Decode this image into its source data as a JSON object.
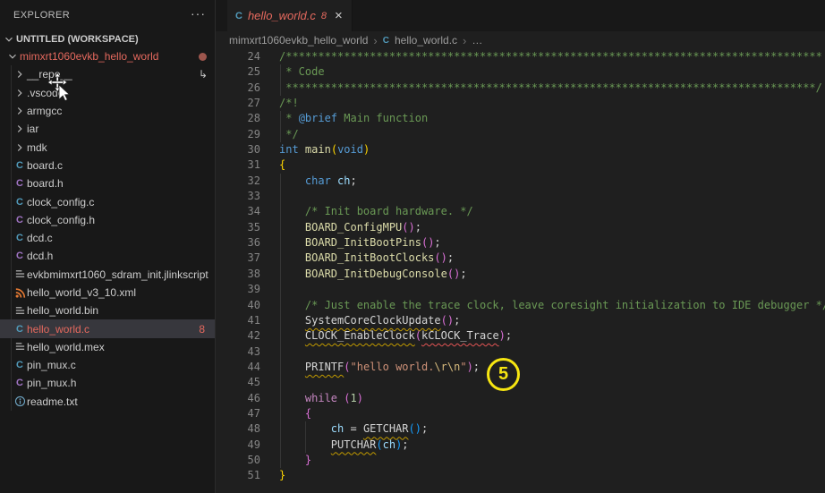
{
  "explorer": {
    "title": "EXPLORER",
    "workspace_label": "UNTITLED (WORKSPACE)",
    "tree": [
      {
        "label": "mimxrt1060evkb_hello_world",
        "type": "folder",
        "level": 0,
        "expanded": true,
        "color": "red",
        "trailing": "dot"
      },
      {
        "label": "__repo__",
        "type": "folder",
        "level": 1,
        "trailing": "return-arrow"
      },
      {
        "label": ".vscode",
        "type": "folder",
        "level": 1
      },
      {
        "label": "armgcc",
        "type": "folder",
        "level": 1
      },
      {
        "label": "iar",
        "type": "folder",
        "level": 1
      },
      {
        "label": "mdk",
        "type": "folder",
        "level": 1
      },
      {
        "label": "board.c",
        "type": "file",
        "icon": "c-source-icon",
        "level": 1
      },
      {
        "label": "board.h",
        "type": "file",
        "icon": "c-header-icon",
        "level": 1
      },
      {
        "label": "clock_config.c",
        "type": "file",
        "icon": "c-source-icon",
        "level": 1
      },
      {
        "label": "clock_config.h",
        "type": "file",
        "icon": "c-header-icon",
        "level": 1
      },
      {
        "label": "dcd.c",
        "type": "file",
        "icon": "c-source-icon",
        "level": 1
      },
      {
        "label": "dcd.h",
        "type": "file",
        "icon": "c-header-icon",
        "level": 1
      },
      {
        "label": "evkbmimxrt1060_sdram_init.jlinkscript",
        "type": "file",
        "icon": "doc-icon",
        "level": 1
      },
      {
        "label": "hello_world_v3_10.xml",
        "type": "file",
        "icon": "xml-icon",
        "level": 1
      },
      {
        "label": "hello_world.bin",
        "type": "file",
        "icon": "doc-icon",
        "level": 1
      },
      {
        "label": "hello_world.c",
        "type": "file",
        "icon": "c-source-icon",
        "level": 1,
        "selected": true,
        "color": "red",
        "badge": "8"
      },
      {
        "label": "hello_world.mex",
        "type": "file",
        "icon": "doc-icon",
        "level": 1
      },
      {
        "label": "pin_mux.c",
        "type": "file",
        "icon": "c-source-icon",
        "level": 1
      },
      {
        "label": "pin_mux.h",
        "type": "file",
        "icon": "c-header-icon",
        "level": 1
      },
      {
        "label": "readme.txt",
        "type": "file",
        "icon": "info-icon",
        "level": 1
      }
    ]
  },
  "editor": {
    "tab": {
      "label": "hello_world.c",
      "badge": "8",
      "close_glyph": "×"
    },
    "breadcrumb": [
      "mimxrt1060evkb_hello_world",
      "hello_world.c",
      "…"
    ],
    "first_line_number": 24,
    "last_line_number": 51,
    "lines": [
      {
        "n": 24,
        "t": [
          [
            "/***********************************************************************************",
            "cm"
          ]
        ]
      },
      {
        "n": 25,
        "t": [
          [
            " * Code",
            "cm"
          ]
        ]
      },
      {
        "n": 26,
        "t": [
          [
            " **********************************************************************************/",
            "cm"
          ]
        ]
      },
      {
        "n": 27,
        "t": [
          [
            "/*!",
            "cm"
          ]
        ]
      },
      {
        "n": 28,
        "t": [
          [
            " * ",
            "cm"
          ],
          [
            "@brief",
            "doc"
          ],
          [
            " Main function",
            "cm"
          ]
        ]
      },
      {
        "n": 29,
        "t": [
          [
            " */",
            "cm"
          ]
        ]
      },
      {
        "n": 30,
        "t": [
          [
            "int",
            "kw"
          ],
          [
            " ",
            "pl"
          ],
          [
            "main",
            "fn"
          ],
          [
            "(",
            "b1"
          ],
          [
            "void",
            "kw"
          ],
          [
            ")",
            "b1"
          ]
        ]
      },
      {
        "n": 31,
        "t": [
          [
            "{",
            "b1"
          ]
        ]
      },
      {
        "n": 32,
        "t": [
          [
            "    ",
            "pl"
          ],
          [
            "char",
            "kw"
          ],
          [
            " ",
            "pl"
          ],
          [
            "ch",
            "var"
          ],
          [
            ";",
            "pl"
          ]
        ]
      },
      {
        "n": 33,
        "t": []
      },
      {
        "n": 34,
        "t": [
          [
            "    ",
            "pl"
          ],
          [
            "/* Init board hardware. */",
            "cm"
          ]
        ]
      },
      {
        "n": 35,
        "t": [
          [
            "    ",
            "pl"
          ],
          [
            "BOARD_ConfigMPU",
            "fn"
          ],
          [
            "(",
            "b2"
          ],
          [
            ")",
            "b2"
          ],
          [
            ";",
            "pl"
          ]
        ]
      },
      {
        "n": 36,
        "t": [
          [
            "    ",
            "pl"
          ],
          [
            "BOARD_InitBootPins",
            "fn"
          ],
          [
            "(",
            "b2"
          ],
          [
            ")",
            "b2"
          ],
          [
            ";",
            "pl"
          ]
        ]
      },
      {
        "n": 37,
        "t": [
          [
            "    ",
            "pl"
          ],
          [
            "BOARD_InitBootClocks",
            "fn"
          ],
          [
            "(",
            "b2"
          ],
          [
            ")",
            "b2"
          ],
          [
            ";",
            "pl"
          ]
        ]
      },
      {
        "n": 38,
        "t": [
          [
            "    ",
            "pl"
          ],
          [
            "BOARD_InitDebugConsole",
            "fn"
          ],
          [
            "(",
            "b2"
          ],
          [
            ")",
            "b2"
          ],
          [
            ";",
            "pl"
          ]
        ]
      },
      {
        "n": 39,
        "t": []
      },
      {
        "n": 40,
        "t": [
          [
            "    ",
            "pl"
          ],
          [
            "/* Just enable the trace clock, leave coresight initialization to IDE debugger */",
            "cm"
          ]
        ]
      },
      {
        "n": 41,
        "t": [
          [
            "    ",
            "pl"
          ],
          [
            "SystemCoreClockUpdate",
            "plw"
          ],
          [
            "(",
            "b2"
          ],
          [
            ")",
            "b2"
          ],
          [
            ";",
            "pl"
          ]
        ]
      },
      {
        "n": 42,
        "t": [
          [
            "    ",
            "pl"
          ],
          [
            "CLOCK_EnableClock",
            "plw"
          ],
          [
            "(",
            "b2"
          ],
          [
            "kCLOCK_Trace",
            "ple"
          ],
          [
            ")",
            "b2"
          ],
          [
            ";",
            "pl"
          ]
        ]
      },
      {
        "n": 43,
        "t": []
      },
      {
        "n": 44,
        "t": [
          [
            "    ",
            "pl"
          ],
          [
            "PRINTF",
            "plw"
          ],
          [
            "(",
            "b2"
          ],
          [
            "\"hello world.",
            "str"
          ],
          [
            "\\r\\n",
            "esc"
          ],
          [
            "\"",
            "str"
          ],
          [
            ")",
            "b2"
          ],
          [
            ";",
            "pl"
          ]
        ]
      },
      {
        "n": 45,
        "t": []
      },
      {
        "n": 46,
        "t": [
          [
            "    ",
            "pl"
          ],
          [
            "while",
            "ctrl"
          ],
          [
            " ",
            "pl"
          ],
          [
            "(",
            "b2"
          ],
          [
            "1",
            "num"
          ],
          [
            ")",
            "b2"
          ]
        ]
      },
      {
        "n": 47,
        "t": [
          [
            "    ",
            "pl"
          ],
          [
            "{",
            "b2"
          ]
        ]
      },
      {
        "n": 48,
        "t": [
          [
            "        ",
            "pl"
          ],
          [
            "ch",
            "var"
          ],
          [
            " = ",
            "pl"
          ],
          [
            "GETCHAR",
            "plw"
          ],
          [
            "(",
            "b3"
          ],
          [
            ")",
            "b3"
          ],
          [
            ";",
            "pl"
          ]
        ]
      },
      {
        "n": 49,
        "t": [
          [
            "        ",
            "pl"
          ],
          [
            "PUTCHAR",
            "plw"
          ],
          [
            "(",
            "b3"
          ],
          [
            "ch",
            "var"
          ],
          [
            ")",
            "b3"
          ],
          [
            ";",
            "pl"
          ]
        ]
      },
      {
        "n": 50,
        "t": [
          [
            "    ",
            "pl"
          ],
          [
            "}",
            "b2"
          ]
        ]
      },
      {
        "n": 51,
        "t": [
          [
            "}",
            "b1"
          ]
        ]
      }
    ]
  },
  "annotation": {
    "label": "5"
  },
  "colors": {
    "sidebar_bg": "#181818",
    "editor_bg": "#1f1f1f",
    "error_red": "#e5695e",
    "warning_underline": "#c19a00",
    "error_underline": "#e45454",
    "annotation_yellow": "#f6e511",
    "modified_dot": "#9d564d",
    "c_source_icon": "#519aba",
    "c_header_icon": "#a074c4",
    "xml_icon": "#e37933"
  }
}
